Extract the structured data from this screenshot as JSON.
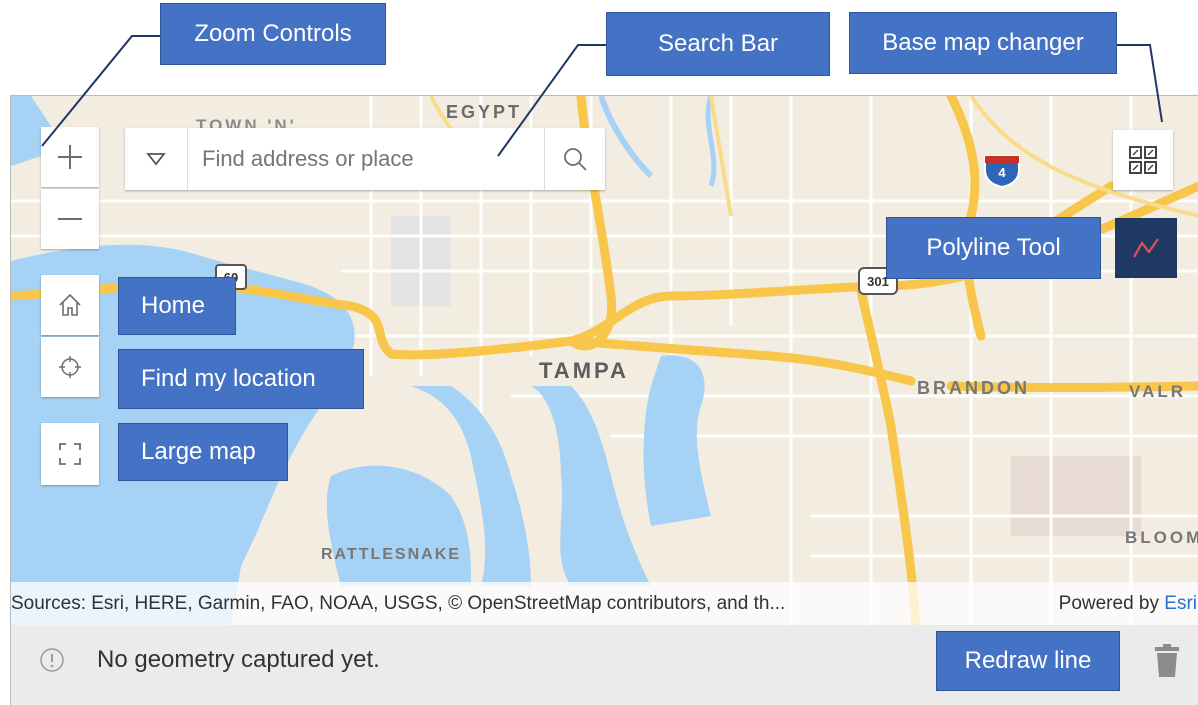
{
  "map": {
    "places": {
      "egypt": "EGYPT",
      "tampa": "TAMPA",
      "brandon": "BRANDON",
      "valr": "VALR",
      "bloom": "BLOOM",
      "rattlesnake": "RATTLESNAKE",
      "town": "TOWN 'N'"
    },
    "shields": {
      "us60": "60",
      "us301": "301",
      "i4": "4"
    },
    "attribution": {
      "sources": "Sources: Esri, HERE, Garmin, FAO, NOAA, USGS, © OpenStreetMap contributors, and th...",
      "powered_by": "Powered by",
      "powered_link": "Esri"
    },
    "colors": {
      "land": "#f3ece1",
      "water": "#a6d2f5",
      "highway": "#f7c64a",
      "road": "#ffffff",
      "park": "#d9e5c8"
    }
  },
  "search": {
    "placeholder": "Find address or place"
  },
  "status": {
    "message": "No geometry captured yet."
  },
  "callouts": {
    "zoom": "Zoom Controls",
    "search": "Search Bar",
    "basemap": "Base map changer",
    "polyline": "Polyline Tool",
    "home": "Home",
    "locate": "Find my location",
    "large": "Large map",
    "redraw": "Redraw line"
  },
  "icons": {
    "zoom_in": "plus-icon",
    "zoom_out": "minus-icon",
    "home": "home-icon",
    "locate": "crosshair-icon",
    "fullscreen": "expand-icon",
    "search_dropdown": "chevron-down-icon",
    "search": "search-icon",
    "basemap": "basemap-gallery-icon",
    "polyline": "polyline-icon",
    "info": "info-icon",
    "trash": "trash-icon"
  },
  "accent_colors": {
    "callout": "#4472c4",
    "polyline_button": "#1f3864",
    "polyline_stroke": "#e05252"
  }
}
